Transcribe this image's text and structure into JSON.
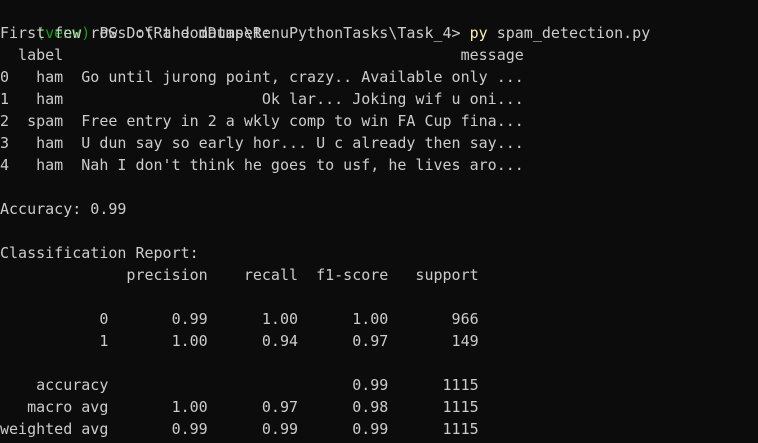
{
  "terminal": {
    "prompt": {
      "venv": "(venv)",
      "ps": " PS D:\\RandomDump\\RenuPythonTasks\\Task_4> ",
      "command": "py",
      "args": " spam_detection.py"
    },
    "lines": [
      "First few rows of the dataset:",
      "  label                                            message",
      "0   ham  Go until jurong point, crazy.. Available only ...",
      "1   ham                      Ok lar... Joking wif u oni...",
      "2  spam  Free entry in 2 a wkly comp to win FA Cup fina...",
      "3   ham  U dun say so early hor... U c already then say...",
      "4   ham  Nah I don't think he goes to usf, he lives aro...",
      "",
      "Accuracy: 0.99",
      "",
      "Classification Report:",
      "              precision    recall  f1-score   support",
      "",
      "           0       0.99      1.00      1.00       966",
      "           1       1.00      0.94      0.97       149",
      "",
      "    accuracy                           0.99      1115",
      "   macro avg       1.00      0.97      0.98      1115",
      "weighted avg       0.99      0.99      0.99      1115"
    ]
  },
  "colors": {
    "background": "#0c0c0c",
    "text": "#cccccc",
    "venv": "#13a10e",
    "command": "#f9f1a5"
  }
}
